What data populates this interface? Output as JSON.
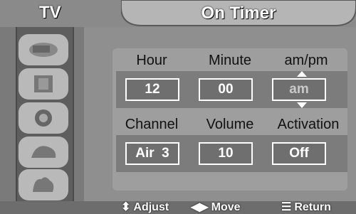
{
  "header": {
    "tv_label": "TV",
    "title": "On Timer"
  },
  "sidebar": {
    "icons": [
      "picture-icon",
      "sound-icon",
      "channel-icon",
      "setup-icon",
      "input-icon"
    ]
  },
  "fields": {
    "hour_label": "Hour",
    "minute_label": "Minute",
    "ampm_label": "am/pm",
    "hour_value": "12",
    "minute_value": "00",
    "ampm_value": "am",
    "channel_label": "Channel",
    "volume_label": "Volume",
    "activation_label": "Activation",
    "channel_value": "Air  3",
    "volume_value": "10",
    "activation_value": "Off"
  },
  "footer": {
    "adjust": "Adjust",
    "move": "Move",
    "return": "Return"
  }
}
